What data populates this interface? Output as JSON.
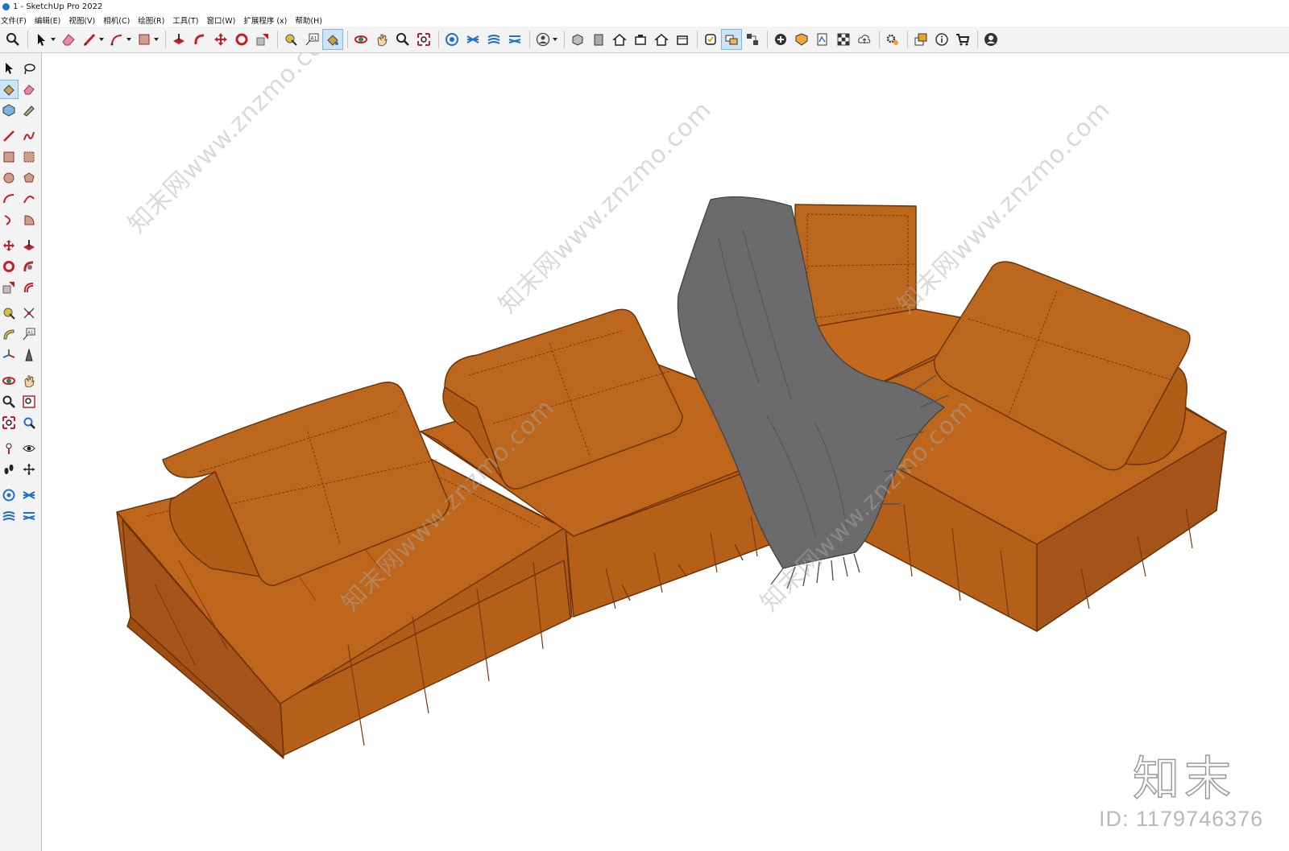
{
  "window": {
    "title": "1 - SketchUp Pro 2022"
  },
  "menu": [
    "文件(F)",
    "编辑(E)",
    "视图(V)",
    "相机(C)",
    "绘图(R)",
    "工具(T)",
    "窗口(W)",
    "扩展程序 (x)",
    "帮助(H)"
  ],
  "toolbar_icons": [
    "search-icon",
    "select-icon",
    "eraser-icon",
    "pencil-icon",
    "arc-icon",
    "rectangle-icon",
    "push-pull-icon",
    "follow-me-icon",
    "move-icon",
    "rotate-icon",
    "scale-icon",
    "tape-measure-icon",
    "text-icon",
    "paint-bucket-icon",
    "orbit-icon",
    "pan-icon",
    "zoom-icon",
    "zoom-extents-icon",
    "warehouse-icon",
    "sandbox-icon",
    "sandbox-stamp-icon",
    "sandbox-drape-icon",
    "user-icon",
    "iso-view-icon",
    "front-view-icon",
    "top-view-icon",
    "right-view-icon",
    "back-view-icon",
    "left-view-icon",
    "section-plane-icon",
    "section-display-icon",
    "section-cut-icon",
    "generate-report-icon",
    "solid-tools-icon",
    "layout-icon",
    "style-builder-icon",
    "cloud-upload-icon",
    "settings-icon",
    "layers-icon",
    "info-icon",
    "cart-icon",
    "account-icon"
  ],
  "viewport": {
    "watermarks": [
      "知末网www.znzmo.com"
    ],
    "logo_text": "知末",
    "id_text": "ID: 1179746376"
  },
  "colors": {
    "sofa": "#c2691d",
    "sofa_dark": "#a8561a",
    "throw": "#6f6f6f",
    "accent": "#1f6fd0"
  }
}
